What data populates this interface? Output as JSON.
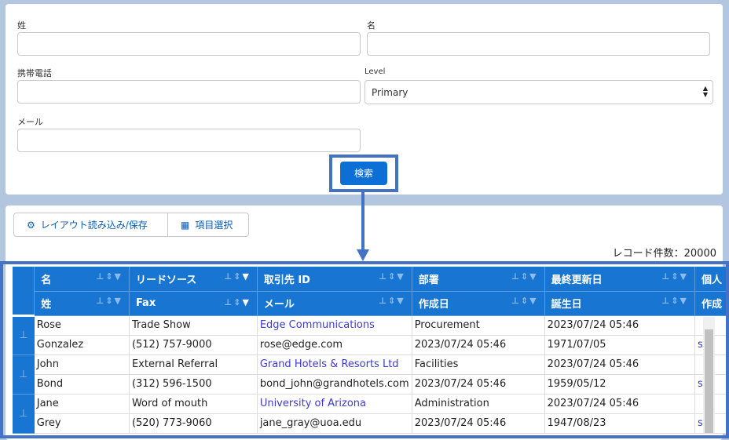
{
  "form": {
    "last_name_label": "姓",
    "first_name_label": "名",
    "mobile_label": "携帯電話",
    "level_label": "Level",
    "level_value": "Primary",
    "email_label": "メール",
    "search_button": "検索"
  },
  "toolbar": {
    "layout_button": "レイアウト読み込み/保存",
    "fields_button": "項目選択",
    "record_count": "レコード件数：20000"
  },
  "table": {
    "headers_top": [
      "名",
      "リードソース",
      "取引先 ID",
      "部署",
      "最終更新日",
      "個人"
    ],
    "headers_bottom": [
      "姓",
      "Fax",
      "メール",
      "作成日",
      "誕生日",
      "作成"
    ],
    "rows": [
      [
        "Rose",
        "Trade Show",
        "Edge Communications",
        "Procurement",
        "2023/07/24 05:46",
        ""
      ],
      [
        "Gonzalez",
        "(512) 757-9000",
        "rose@edge.com",
        "2023/07/24 05:46",
        "1971/07/05",
        "s"
      ],
      [
        "John",
        "External Referral",
        "Grand Hotels & Resorts Ltd",
        "Facilities",
        "2023/07/24 05:46",
        ""
      ],
      [
        "Bond",
        "(312) 596-1500",
        "bond_john@grandhotels.com",
        "2023/07/24 05:46",
        "1959/05/12",
        "s"
      ],
      [
        "Jane",
        "Word of mouth",
        "University of Arizona",
        "Administration",
        "2023/07/24 05:46",
        ""
      ],
      [
        "Grey",
        "(520) 773-9060",
        "jane_gray@uoa.edu",
        "2023/07/24 05:46",
        "1947/08/23",
        "s"
      ]
    ]
  },
  "colors": {
    "accent": "#1876d2",
    "highlight": "#4472c4"
  }
}
